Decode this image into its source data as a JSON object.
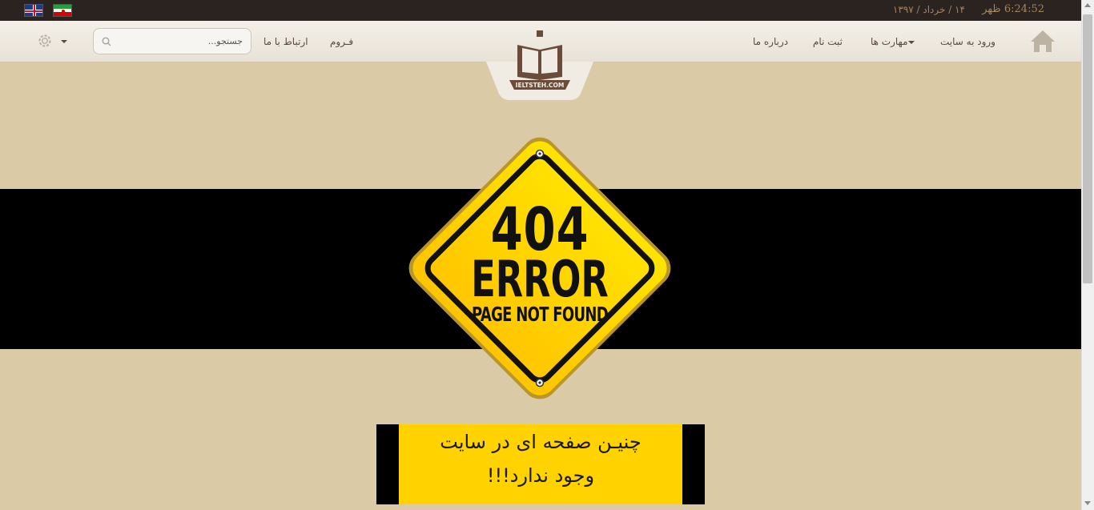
{
  "topbar": {
    "languages": [
      {
        "name": "english-flag-icon"
      },
      {
        "name": "iran-flag-icon"
      }
    ],
    "date": "۱۴ / خرداد / ۱۳۹۷",
    "time": "6:24:52 ظهر"
  },
  "nav": {
    "home_icon": "home-icon",
    "items": [
      {
        "label": "ورود به سایت"
      },
      {
        "label": "مهارت ها"
      },
      {
        "label": "ثبت نام"
      },
      {
        "label": "درباره ما"
      },
      {
        "label": "فـروم"
      },
      {
        "label": "ارتباط با ما"
      }
    ],
    "search_placeholder": "جستجو...",
    "settings_icon": "gear-icon"
  },
  "logo": {
    "text": "IELTSTEH.COM"
  },
  "error": {
    "code": "404",
    "title": "ERROR",
    "subtitle": "PAGE NOT FOUND",
    "message_line1": "چنیـن صفحه ای در سایت",
    "message_line2": "وجود ندارد!!!"
  },
  "colors": {
    "background": "#dbcaa6",
    "topbar": "#2a2320",
    "sign_yellow": "#ffd200",
    "band": "#000000"
  }
}
